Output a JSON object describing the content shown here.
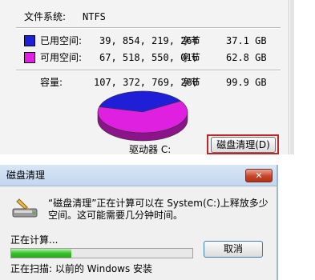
{
  "properties": {
    "filesystem": {
      "label": "文件系统:",
      "value": "NTFS"
    },
    "used": {
      "label": "已用空间:",
      "bytes": "39, 854, 219, 264",
      "unit": "字节",
      "size": "37.1 GB",
      "color": "#1f1fd8"
    },
    "free": {
      "label": "可用空间:",
      "bytes": "67, 518, 550, 016",
      "unit": "字节",
      "size": "62.8 GB",
      "color": "#e020e0"
    },
    "capacity": {
      "label": "容量:",
      "bytes": "107, 372, 769, 280",
      "unit": "字节",
      "size": "99.9 GB"
    },
    "drive_label": "驱动器 C:",
    "cleanup_button": "磁盘清理(D)"
  },
  "dialog": {
    "title": "磁盘清理",
    "close_glyph": "✕",
    "message": "“磁盘清理”正在计算可以在 System(C:)上释放多少空间。这可能需要几分钟时间。",
    "status_label": "正在计算...",
    "progress": 0.33,
    "cancel_button": "取消",
    "scan_text": "正在扫描: 以前的 Windows 安装"
  },
  "chart_data": {
    "type": "pie",
    "series": [
      {
        "name": "已用空间",
        "value": 37.1,
        "color": "#1f1fd8"
      },
      {
        "name": "可用空间",
        "value": 62.8,
        "color": "#e020e0"
      }
    ]
  }
}
